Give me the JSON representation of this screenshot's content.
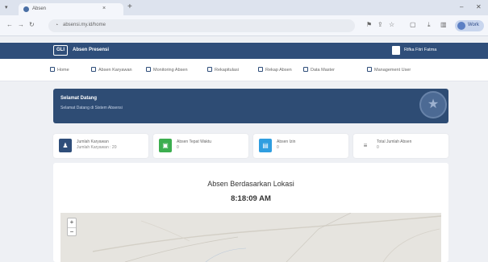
{
  "browser": {
    "tab_title": "Absen",
    "tab_close": "×",
    "new_tab": "+",
    "url": "absensi.my.id/home",
    "profile": "Work",
    "icons": [
      "back-icon",
      "forward-icon",
      "reload-icon",
      "lock-icon",
      "translate-icon",
      "share-icon",
      "star-icon",
      "extensions-icon",
      "download-icon",
      "menu-icon"
    ]
  },
  "app": {
    "logo": "GLI",
    "title": "Absen Presensi",
    "user_name": "Rifka Fitri Fatma"
  },
  "nav": {
    "items": [
      {
        "label": "Home"
      },
      {
        "label": "Absen Karyawan"
      },
      {
        "label": "Monitoring Absen"
      },
      {
        "label": "Rekapitulasi"
      },
      {
        "label": "Rekap Absen"
      },
      {
        "label": "Data Master"
      },
      {
        "label": "Management User"
      }
    ]
  },
  "banner": {
    "title": "Selamat Datang",
    "subtitle": "Selamat Datang di Sistem Absensi",
    "badge_icon": "star-badge-icon"
  },
  "cards": [
    {
      "label": "Jumlah Karyawan",
      "value": "Jumlah Karyawan : 20",
      "icon": "user-icon",
      "color": "#2f4e7a"
    },
    {
      "label": "Absen Tepat Waktu",
      "value": "0",
      "icon": "check-icon",
      "color": "#3cae4f"
    },
    {
      "label": "Absen Izin",
      "value": "0",
      "icon": "calendar-icon",
      "color": "#2f9ee0"
    },
    {
      "label": "Total Jumlah Absen",
      "value": "0",
      "icon": "list-icon",
      "color": "#ffffff"
    }
  ],
  "main": {
    "title": "Absen Berdasarkan Lokasi",
    "time": "8:18:09 AM",
    "zoom_in": "+",
    "zoom_out": "−"
  }
}
